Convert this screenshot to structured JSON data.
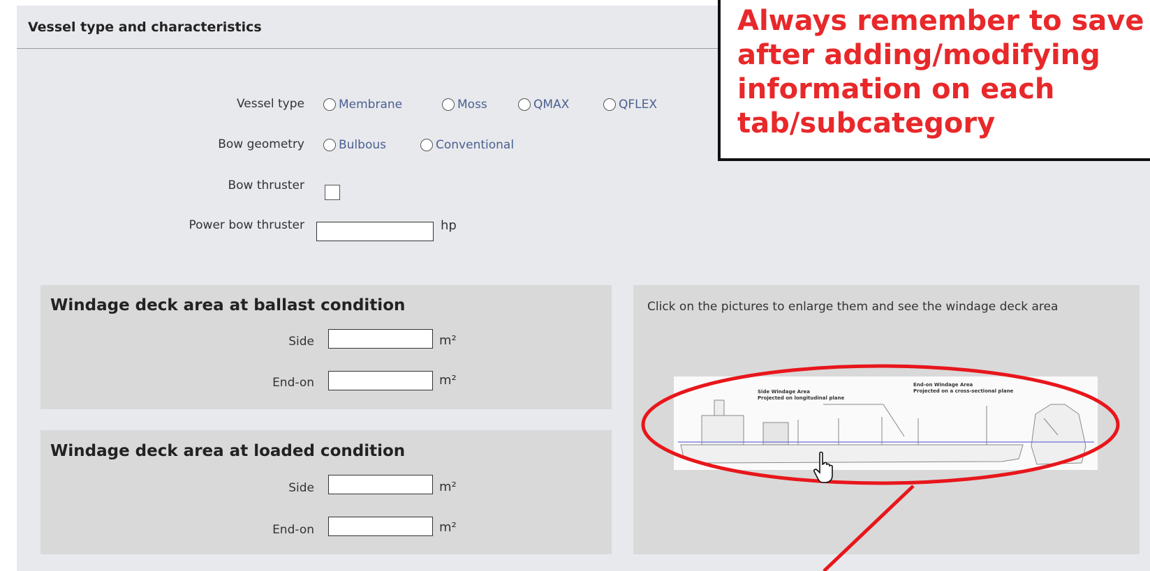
{
  "section": {
    "title": "Vessel type and characteristics"
  },
  "fields": {
    "vessel_type_label": "Vessel type",
    "vessel_type_options": [
      "Membrane",
      "Moss",
      "QMAX",
      "QFLEX"
    ],
    "bow_geometry_label": "Bow geometry",
    "bow_geometry_options": [
      "Bulbous",
      "Conventional"
    ],
    "bow_thruster_label": "Bow thruster",
    "power_bow_thruster_label": "Power bow thruster",
    "power_unit": "hp"
  },
  "ballast": {
    "title": "Windage deck area at ballast condition",
    "side_label": "Side",
    "endon_label": "End-on",
    "unit": "m²"
  },
  "loaded": {
    "title": "Windage deck area at loaded condition",
    "side_label": "Side",
    "endon_label": "End-on",
    "unit": "m²"
  },
  "pictures": {
    "hint": "Click on the pictures to enlarge them and see the windage deck area",
    "side_caption_1": "Side Windage Area",
    "side_caption_2": "Projected on longitudinal plane",
    "endon_caption_1": "End-on Windage Area",
    "endon_caption_2": "Projected on a cross-sectional plane"
  },
  "callout": {
    "text": "Always remember to save after adding/modifying information on each tab/subcategory"
  },
  "colors": {
    "callout_text": "#e8282a",
    "annotation": "#e8161b",
    "link_text": "#4a5f8f"
  },
  "icons": {
    "cursor": "hand-pointer-icon"
  }
}
